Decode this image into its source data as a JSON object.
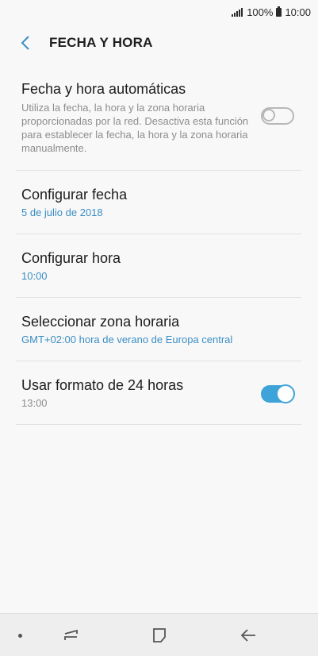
{
  "status_bar": {
    "battery_percent": "100%",
    "time": "10:00",
    "icons": [
      "signal-icon",
      "battery-icon"
    ]
  },
  "app_bar": {
    "title": "FECHA Y HORA",
    "back_icon": "back-arrow-icon"
  },
  "settings": {
    "auto": {
      "title": "Fecha y hora automáticas",
      "description": "Utiliza la fecha, la hora y la zona horaria proporcionadas por la red. Desactiva esta función para establecer la fecha, la hora y la zona horaria manualmente.",
      "enabled": false
    },
    "date": {
      "title": "Configurar fecha",
      "value": "5 de julio de 2018"
    },
    "time": {
      "title": "Configurar hora",
      "value": "10:00"
    },
    "timezone": {
      "title": "Seleccionar zona horaria",
      "value": "GMT+02:00 hora de verano de Europa central"
    },
    "format24": {
      "title": "Usar formato de 24 horas",
      "value": "13:00",
      "enabled": true
    }
  },
  "colors": {
    "accent": "#3ea3d8",
    "link_value": "#3a8ec4",
    "secondary_text": "#8d8d8d"
  },
  "nav_bar": {
    "icons": [
      "dot-icon",
      "recent-apps-icon",
      "home-icon",
      "back-icon"
    ]
  }
}
